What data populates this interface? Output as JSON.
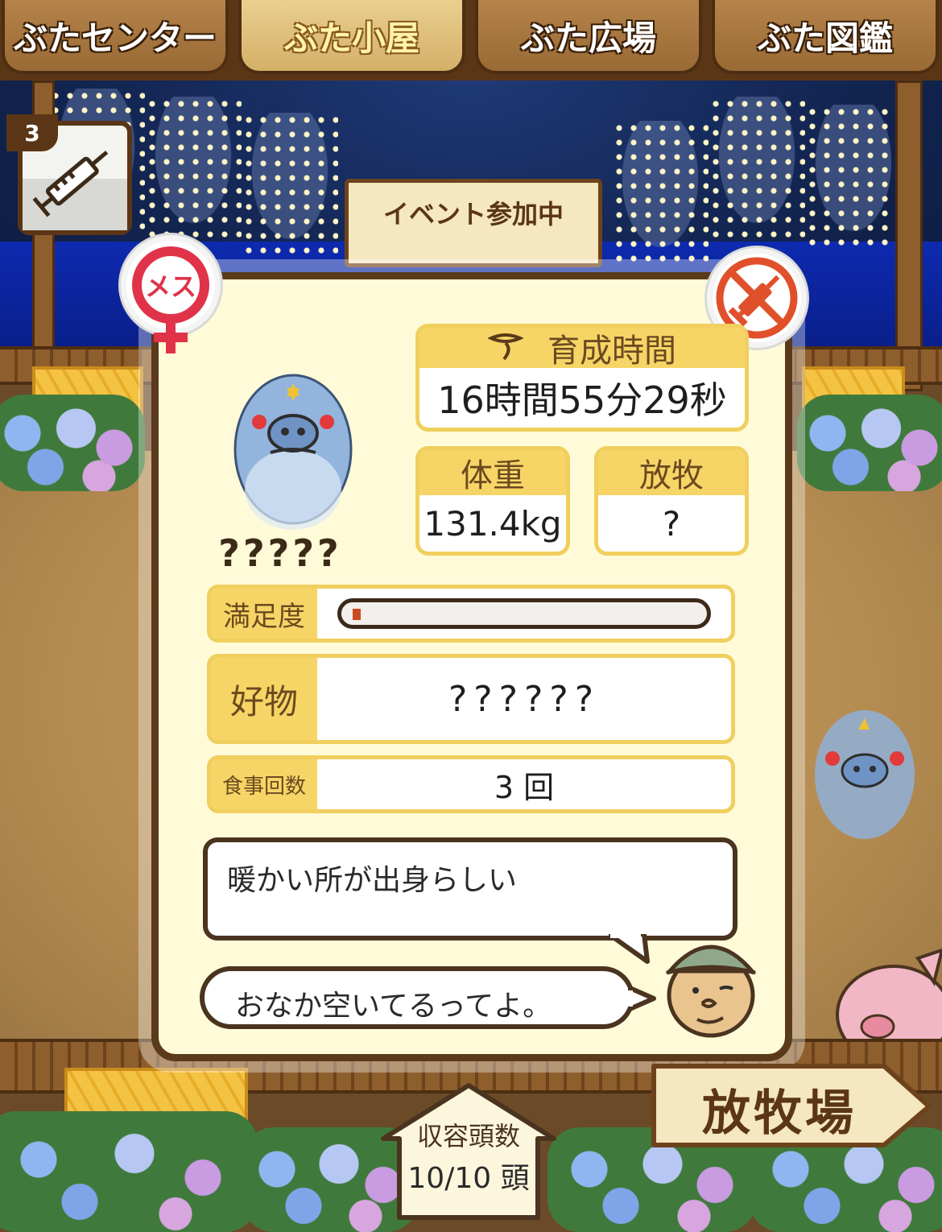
{
  "nav": {
    "tabs": [
      {
        "label": "ぶたセンター",
        "active": false
      },
      {
        "label": "ぶた小屋",
        "active": true
      },
      {
        "label": "ぶた広場",
        "active": false
      },
      {
        "label": "ぶた図鑑",
        "active": false
      }
    ]
  },
  "item": {
    "count": "3",
    "icon": "syringe-icon"
  },
  "event": {
    "label": "イベント参加中"
  },
  "modal": {
    "gender_badge": {
      "label": "メス",
      "icon": "female-icon"
    },
    "no_injection_icon": "no-syringe-icon",
    "pig_name": "?????",
    "growth_time": {
      "label": "育成時間",
      "value": "16時間55分29秒"
    },
    "weight": {
      "label": "体重",
      "value": "131.4kg"
    },
    "grazing": {
      "label": "放牧",
      "value": "?"
    },
    "satisfaction": {
      "label": "満足度",
      "level": 0.02
    },
    "favorite": {
      "label": "好物",
      "value": "??????"
    },
    "meals": {
      "label": "食事回数",
      "value": "3 回"
    },
    "description": "暖かい所が出身らしい",
    "speech": "おなか空いてるってよ。"
  },
  "capacity": {
    "title": "収容頭数",
    "value": "10/10 頭"
  },
  "pasture": {
    "label": "放牧場"
  },
  "colors": {
    "accent": "#f6d566",
    "border": "#5a3a1a",
    "panel": "#fffbd8",
    "alert": "#c84a20"
  }
}
